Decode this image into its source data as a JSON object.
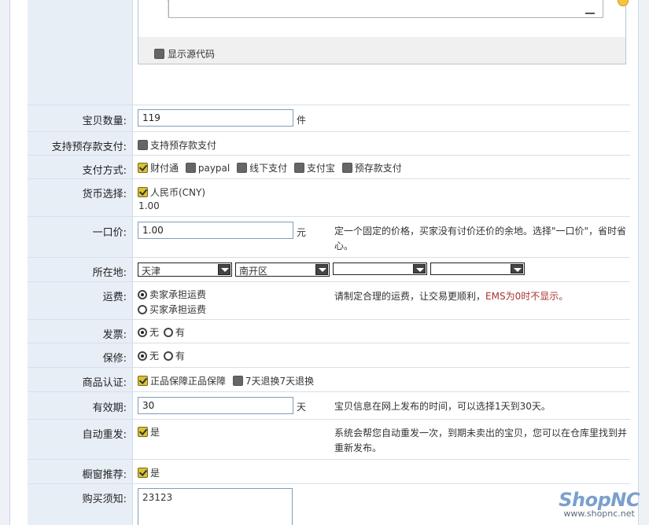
{
  "editor": {
    "show_source_label": "显示源代码"
  },
  "fields": {
    "quantity": {
      "label": "宝贝数量:",
      "value": "119",
      "unit": "件"
    },
    "prepay": {
      "label": "支持预存款支付:",
      "option": "支持预存款支付"
    },
    "payment": {
      "label": "支付方式:",
      "options": [
        "财付通",
        "paypal",
        "线下支付",
        "支付宝",
        "预存款支付"
      ]
    },
    "currency": {
      "label": "货币选择:",
      "option": "人民币(CNY)",
      "rate": "1.00"
    },
    "price": {
      "label": "一口价:",
      "value": "1.00",
      "unit": "元",
      "hint": "定一个固定的价格，买家没有讨价还价的余地。选择\"一口价\"，省时省心。"
    },
    "location": {
      "label": "所在地:",
      "province": "天津",
      "district": "南开区",
      "select3": "",
      "select4": ""
    },
    "shipping": {
      "label": "运费:",
      "options": [
        "卖家承担运费",
        "买家承担运费"
      ],
      "hint_prefix": "请制定合理的运费，让交易更顺利，",
      "hint_ems": "EMS为0时不显示。"
    },
    "invoice": {
      "label": "发票:",
      "no": "无",
      "yes": "有"
    },
    "warranty": {
      "label": "保修:",
      "no": "无",
      "yes": "有"
    },
    "certification": {
      "label": "商品认证:",
      "options": [
        "正品保障正品保障",
        "7天退换7天退换"
      ]
    },
    "validity": {
      "label": "有效期:",
      "value": "30",
      "unit": "天",
      "hint": "宝贝信息在网上发布的时间，可以选择1天到30天。"
    },
    "auto_republish": {
      "label": "自动重发:",
      "option": "是",
      "hint": "系统会帮您自动重发一次，到期未卖出的宝贝，您可以在仓库里找到并重新发布。"
    },
    "window_recommend": {
      "label": "橱窗推荐:",
      "option": "是"
    },
    "purchase_notice": {
      "label": "购买须知:",
      "value": "23123"
    }
  },
  "logo": {
    "brand": "ShopNC",
    "url": "www.shopnc.net"
  },
  "colors": {
    "accent_text": "#a33",
    "label_bg": "#e8eef6",
    "border": "#d6dfeb"
  }
}
